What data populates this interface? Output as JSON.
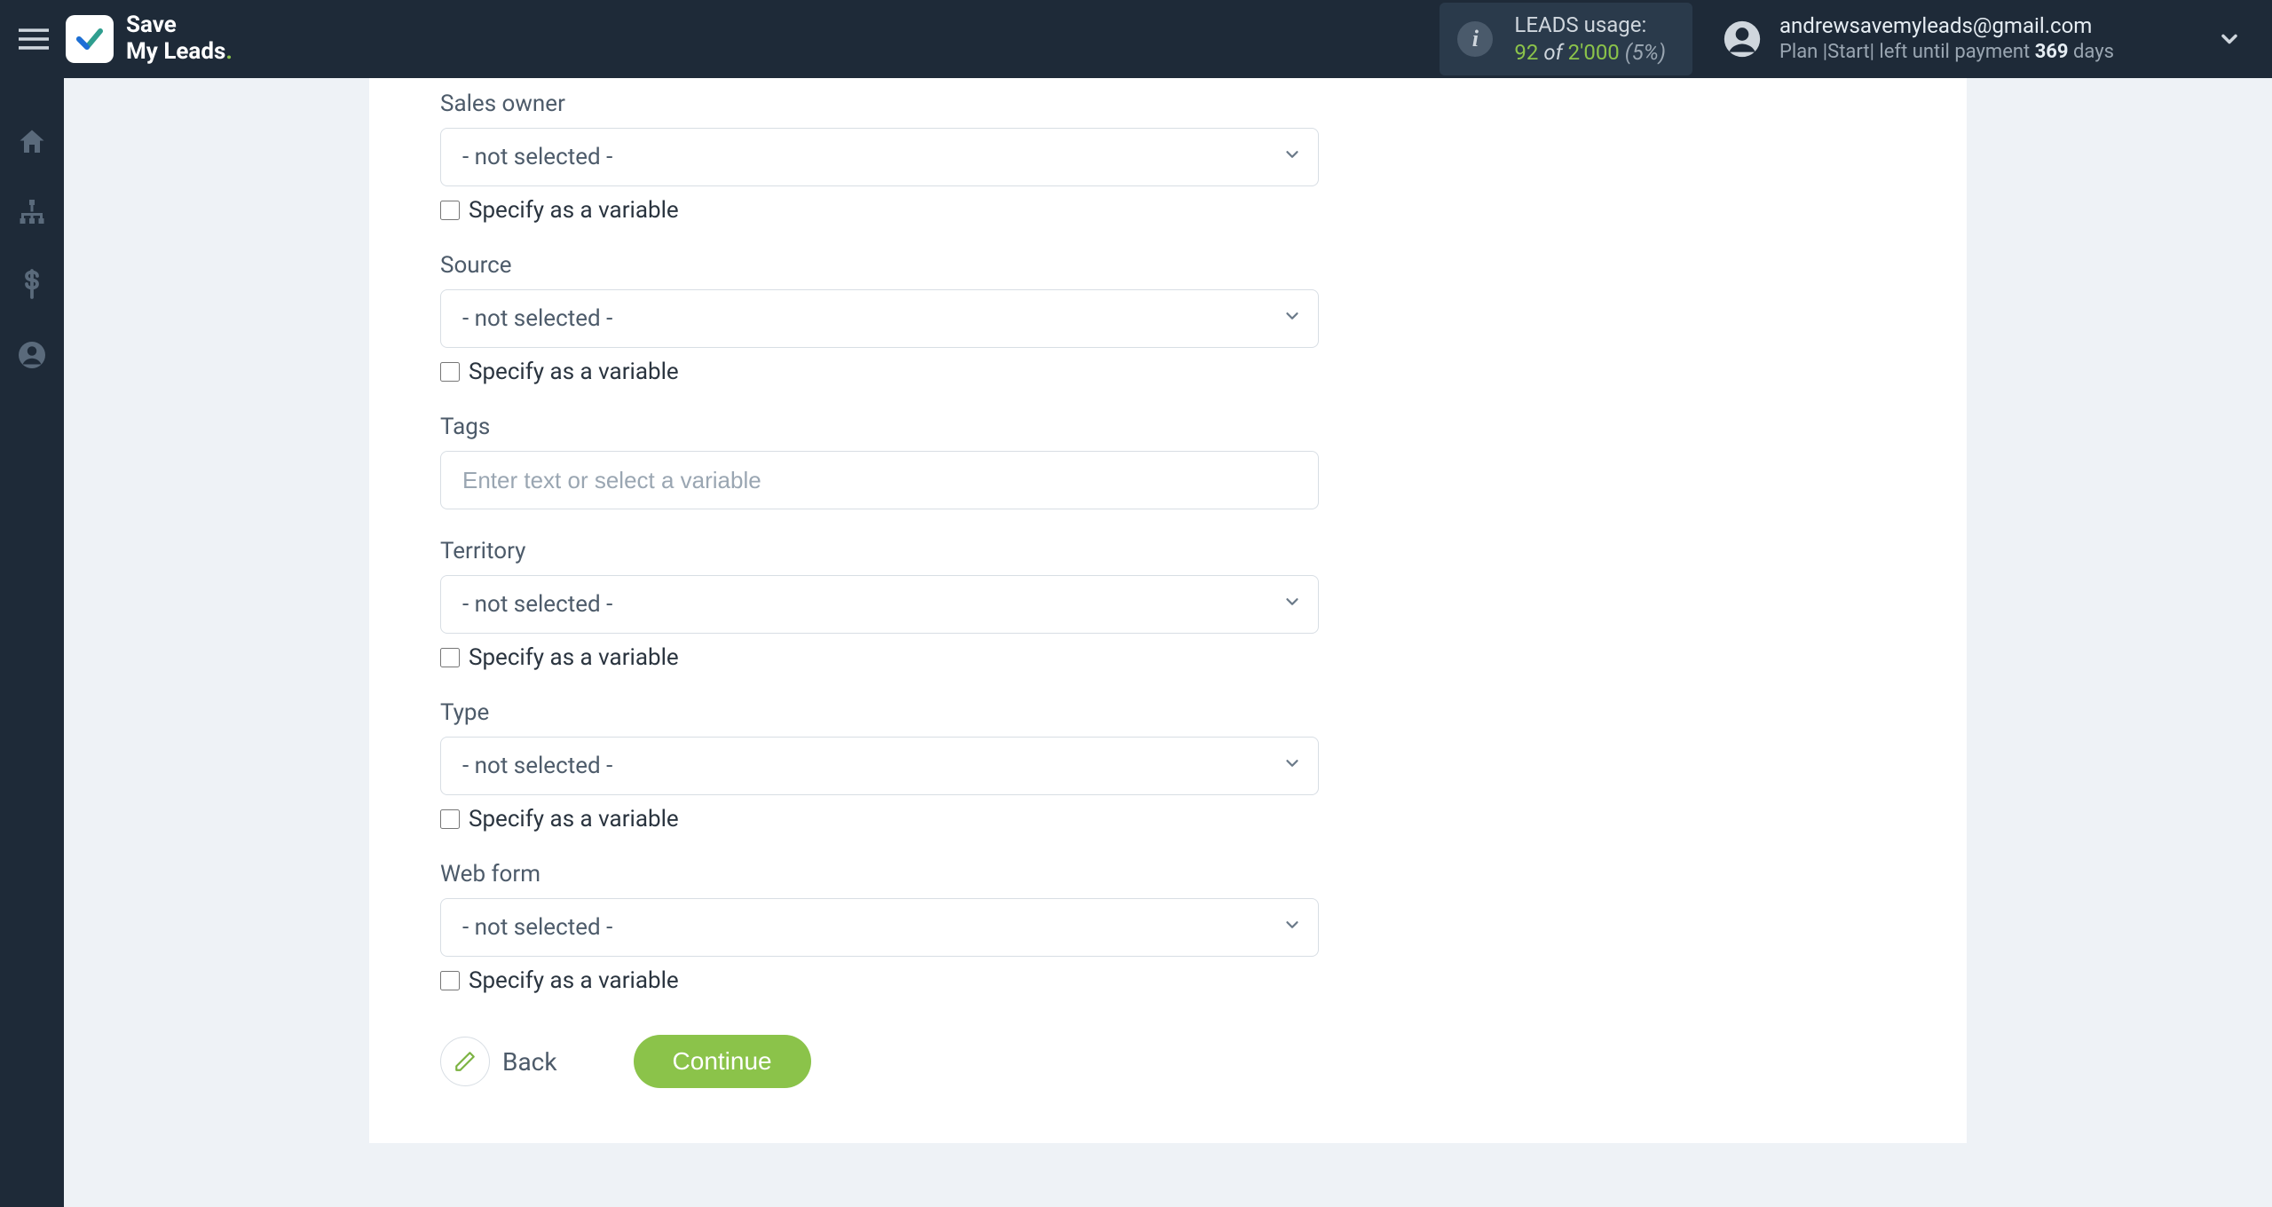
{
  "brand": {
    "line1": "Save",
    "line2": "My Leads"
  },
  "usage": {
    "label": "LEADS usage:",
    "current": "92",
    "of": "of",
    "total": "2'000",
    "pct": "(5%)"
  },
  "account": {
    "email": "andrewsavemyleads@gmail.com",
    "plan_prefix": "Plan |",
    "plan_name": "Start",
    "plan_mid": "| left until payment ",
    "plan_days": "369",
    "plan_suffix": " days"
  },
  "form": {
    "not_selected": "- not selected -",
    "specify_variable": "Specify as a variable",
    "fields": {
      "sales_owner": {
        "label": "Sales owner"
      },
      "source": {
        "label": "Source"
      },
      "tags": {
        "label": "Tags",
        "placeholder": "Enter text or select a variable"
      },
      "territory": {
        "label": "Territory"
      },
      "type": {
        "label": "Type"
      },
      "web_form": {
        "label": "Web form"
      }
    }
  },
  "buttons": {
    "back": "Back",
    "continue": "Continue"
  }
}
